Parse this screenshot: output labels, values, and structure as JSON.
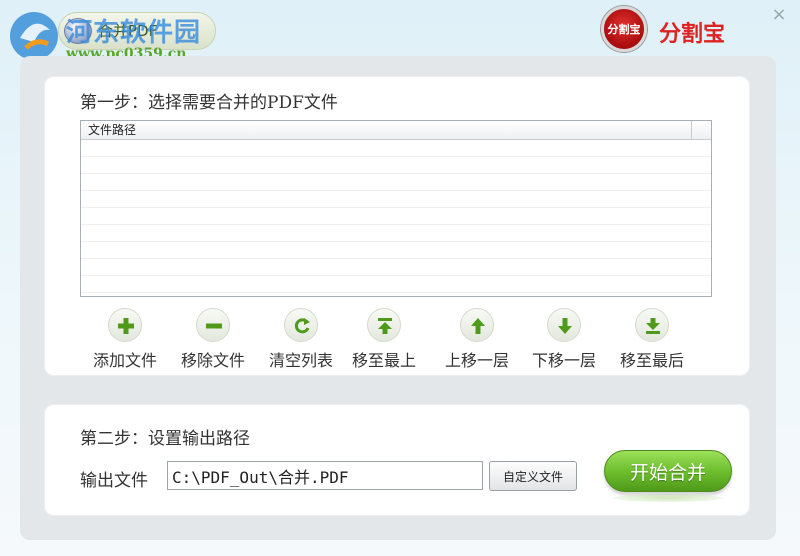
{
  "window": {
    "app_title": "合并PDF",
    "close_glyph": "×"
  },
  "watermark": {
    "site_name": "河东软件园",
    "site_url": "www.pc0359.cn"
  },
  "brand": {
    "logo_text": "分割宝",
    "name": "分割宝"
  },
  "step1": {
    "title": "第一步：选择需要合并的PDF文件",
    "column_header": "文件路径",
    "rows": []
  },
  "toolbar": {
    "items": [
      {
        "label": "添加文件",
        "icon": "plus-icon"
      },
      {
        "label": "移除文件",
        "icon": "minus-icon"
      },
      {
        "label": "清空列表",
        "icon": "refresh-icon"
      },
      {
        "label": "移至最上",
        "icon": "move-top-icon"
      },
      {
        "label": "上移一层",
        "icon": "arrow-up-icon"
      },
      {
        "label": "下移一层",
        "icon": "arrow-down-icon"
      },
      {
        "label": "移至最后",
        "icon": "move-bottom-icon"
      }
    ]
  },
  "step2": {
    "title": "第二步：设置输出路径",
    "output_label": "输出文件",
    "output_value": "C:\\PDF_Out\\合并.PDF",
    "custom_button": "自定义文件",
    "start_button": "开始合并"
  },
  "colors": {
    "accent_green": "#5aa62b",
    "brand_red": "#d22222",
    "watermark_blue": "#3388dd"
  }
}
